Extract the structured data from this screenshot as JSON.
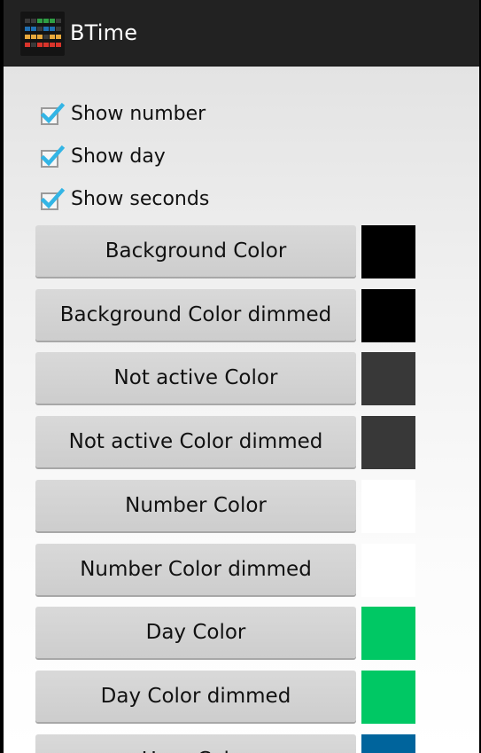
{
  "app": {
    "title": "BTime",
    "icon": "btime-app-icon"
  },
  "checkboxes": [
    {
      "label": "Show number",
      "checked": true
    },
    {
      "label": "Show day",
      "checked": true
    },
    {
      "label": "Show seconds",
      "checked": true
    }
  ],
  "color_buttons": [
    {
      "label": "Background Color",
      "swatch": "#000000"
    },
    {
      "label": "Background Color dimmed",
      "swatch": "#000000"
    },
    {
      "label": "Not active Color",
      "swatch": "#383838"
    },
    {
      "label": "Not active Color dimmed",
      "swatch": "#383838"
    },
    {
      "label": "Number Color",
      "swatch": "#ffffff"
    },
    {
      "label": "Number Color dimmed",
      "swatch": "#ffffff"
    },
    {
      "label": "Day Color",
      "swatch": "#00c864"
    },
    {
      "label": "Day Color dimmed",
      "swatch": "#00c864"
    },
    {
      "label": "Hour Color",
      "swatch": "#00649c"
    }
  ],
  "colors": {
    "actionbar": "#222222",
    "check_accent": "#33b5e5"
  }
}
